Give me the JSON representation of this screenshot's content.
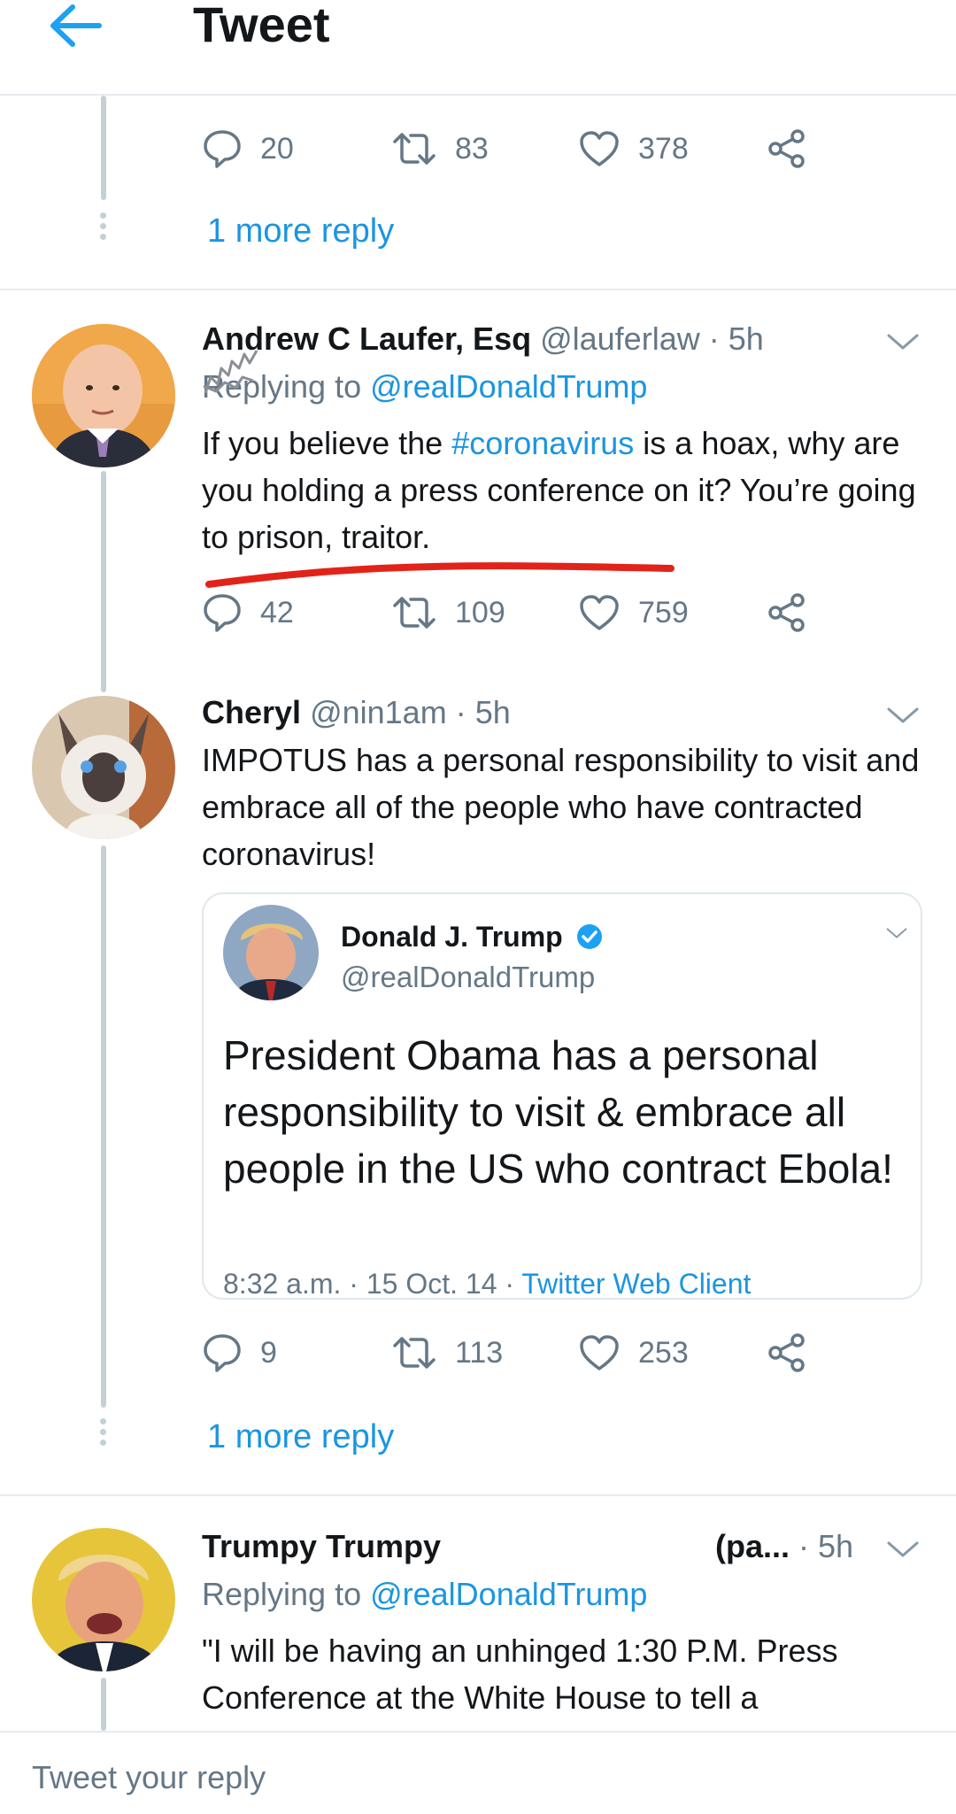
{
  "header": {
    "title": "Tweet"
  },
  "thread_top": {
    "actions": {
      "replies": "20",
      "retweets": "83",
      "likes": "378"
    },
    "more_reply": "1 more reply"
  },
  "tweets": [
    {
      "name": "Andrew C Laufer, Esq",
      "handle": "@lauferlaw",
      "time": "· 5h",
      "replying_prefix": "Replying to ",
      "replying_to": "@realDonaldTrump",
      "text_before": "If you believe the ",
      "hashtag": "#coronavirus",
      "text_after": " is a hoax, why are you holding a press conference on it? You’re going to prison, traitor.",
      "actions": {
        "replies": "42",
        "retweets": "109",
        "likes": "759"
      }
    },
    {
      "name": "Cheryl",
      "handle": "@nin1am",
      "time": "· 5h",
      "text": "IMPOTUS has a personal responsibility to visit and embrace all of the people who have contracted coronavirus!",
      "quote": {
        "name": "Donald J. Trump",
        "handle": "@realDonaldTrump",
        "text": "President Obama has a personal responsibility to visit & embrace all people in the US who contract Ebola!",
        "time": "8:32 a.m. · 15 Oct. 14 · ",
        "client": "Twitter Web Client"
      },
      "actions": {
        "replies": "9",
        "retweets": "113",
        "likes": "253"
      },
      "more_reply": "1 more reply"
    },
    {
      "name": "Trumpy Trumpy",
      "handle": "(pa...",
      "time": "· 5h",
      "replying_prefix": "Replying to ",
      "replying_to": "@realDonaldTrump",
      "text": "\"I will be having an unhinged 1:30 P.M. Press Conference at the White House to tell a"
    }
  ],
  "reply_bar": {
    "placeholder": "Tweet your reply"
  },
  "colors": {
    "link": "#1b95e0",
    "secondary_text": "#657786",
    "divider": "#e6ecf0",
    "annotation_red": "#e2231a"
  },
  "icons": [
    "back-arrow-icon",
    "reply-icon",
    "retweet-icon",
    "like-icon",
    "share-icon",
    "chevron-down-icon",
    "verified-badge-icon"
  ]
}
